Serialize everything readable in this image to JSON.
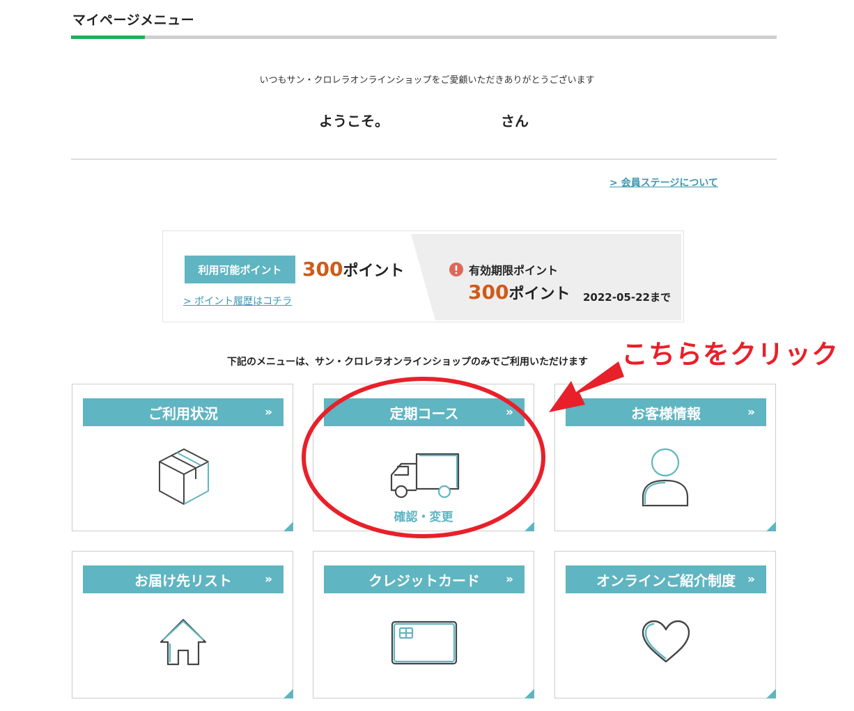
{
  "header": {
    "title": "マイページメニュー"
  },
  "welcome": {
    "greeting": "いつもサン・クロレラオンラインショップをご愛顧いただきありがとうございます",
    "prefix": "ようこそ。",
    "suffix": "さん",
    "member_stage_link": "> 会員ステージについて"
  },
  "points": {
    "available_label": "利用可能ポイント",
    "available_value": "300",
    "points_unit": "ポイント",
    "history_link": "> ポイント履歴はコチラ",
    "expiry_label": "有効期限ポイント",
    "expiry_value": "300",
    "expiry_date": "2022-05-22まで",
    "alert_icon": "exclamation-circle-icon"
  },
  "menu": {
    "note": "下記のメニューは、サン・クロレラオンラインショップのみでご利用いただけます",
    "arrow": "»",
    "cards": [
      {
        "label": "ご利用状況",
        "icon": "box-icon"
      },
      {
        "label": "定期コース",
        "icon": "truck-icon",
        "sub_label": "確認・変更"
      },
      {
        "label": "お客様情報",
        "icon": "person-icon"
      },
      {
        "label": "お届け先リスト",
        "icon": "house-icon"
      },
      {
        "label": "クレジットカード",
        "icon": "credit-card-icon"
      },
      {
        "label": "オンラインご紹介制度",
        "icon": "heart-icon"
      }
    ]
  },
  "annotation": {
    "text": "こちらをクリック",
    "color": "#e8202a"
  },
  "colors": {
    "accent": "#5fb5c1",
    "brand_green": "#1fae5a",
    "points_orange": "#cf5a18",
    "link": "#3a98b0"
  }
}
